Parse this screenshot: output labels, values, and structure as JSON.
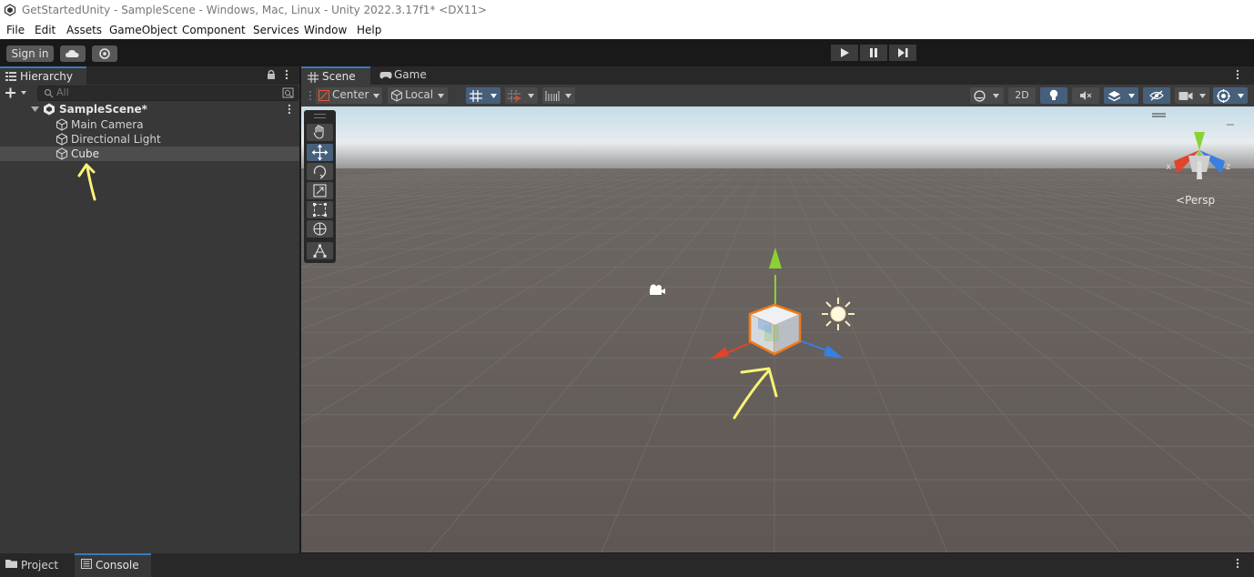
{
  "window": {
    "title": "GetStartedUnity - SampleScene - Windows, Mac, Linux - Unity 2022.3.17f1* <DX11>"
  },
  "menu": [
    "File",
    "Edit",
    "Assets",
    "GameObject",
    "Component",
    "Services",
    "Window",
    "Help"
  ],
  "toolbar": {
    "sign_in": "Sign in",
    "cloud_icon": "cloud-icon",
    "settings_icon": "settings-icon",
    "play_icon": "play-icon",
    "pause_icon": "pause-icon",
    "step_icon": "step-icon"
  },
  "hierarchy": {
    "tab_label": "Hierarchy",
    "search_placeholder": "All",
    "scene_name": "SampleScene*",
    "items": [
      "Main Camera",
      "Directional Light",
      "Cube"
    ],
    "selected": "Cube"
  },
  "scene_view": {
    "tabs": [
      "Scene",
      "Game"
    ],
    "active_tab": "Scene",
    "pivot_mode": "Center",
    "pivot_rotation": "Local",
    "btn_2d": "2D",
    "projection": "Persp",
    "gizmo_axes": [
      "x",
      "y",
      "z"
    ],
    "tools": [
      "hand-tool-icon",
      "move-tool-icon",
      "rotate-tool-icon",
      "scale-tool-icon",
      "rect-tool-icon",
      "transform-tool-icon",
      "custom-tool-icon"
    ],
    "active_tool": "move-tool-icon"
  },
  "bottom_tabs": [
    "Project",
    "Console"
  ],
  "colors": {
    "panel": "#383838",
    "tab_active_border": "#3a79bb",
    "selection_outline": "#f07a1a",
    "annotation": "#f6f376",
    "axis_x": "#e0442a",
    "axis_y": "#8ad132",
    "axis_z": "#3a7ee0"
  }
}
